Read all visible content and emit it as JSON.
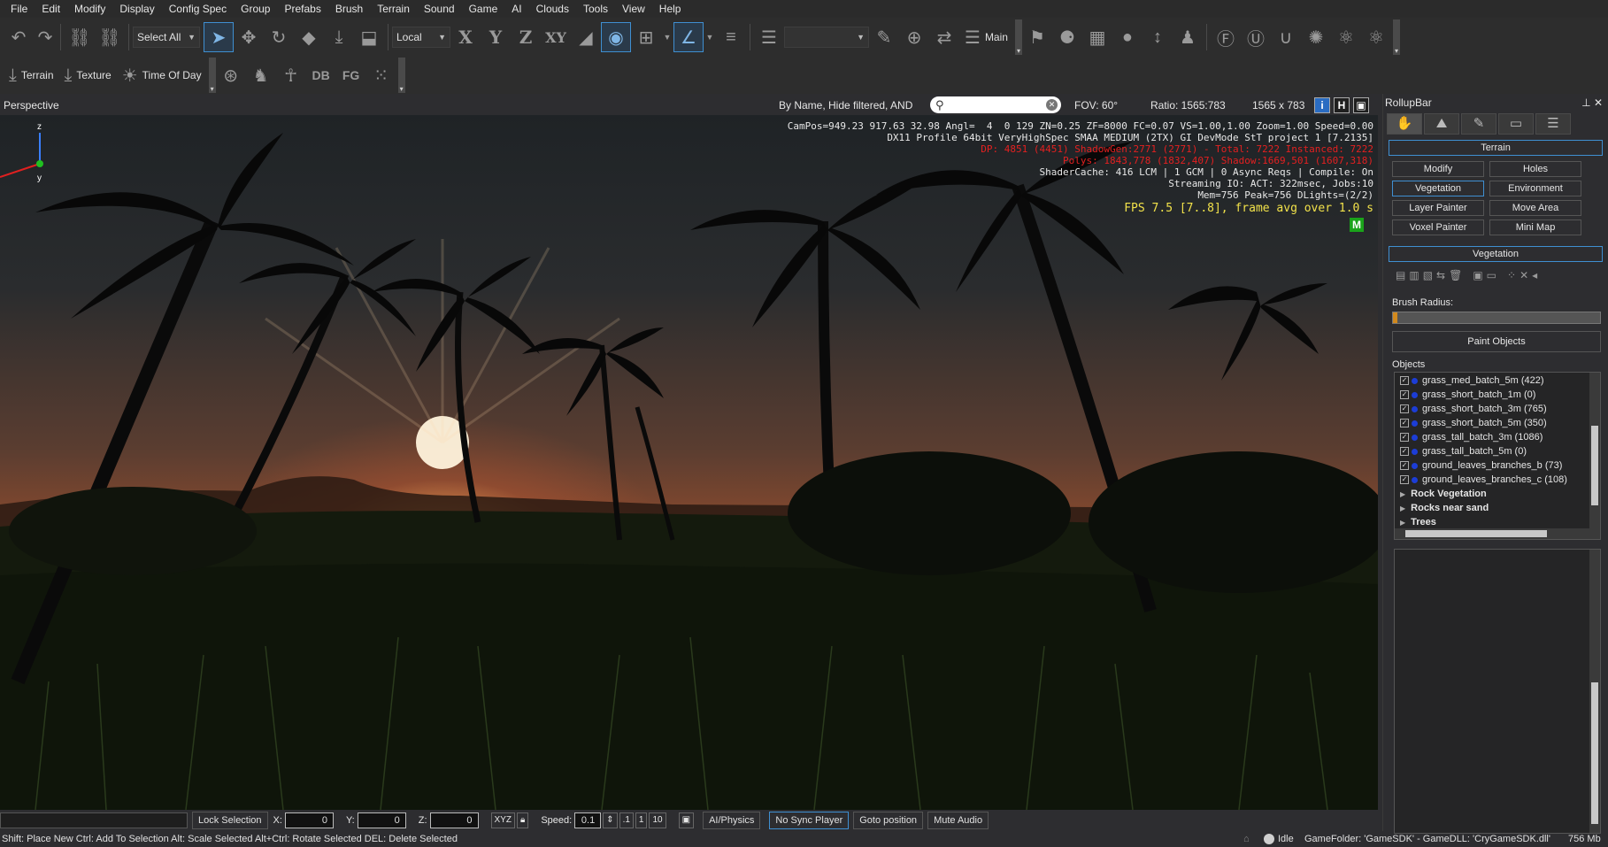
{
  "menu": [
    "File",
    "Edit",
    "Modify",
    "Display",
    "Config Spec",
    "Group",
    "Prefabs",
    "Brush",
    "Terrain",
    "Sound",
    "Game",
    "AI",
    "Clouds",
    "Tools",
    "View",
    "Help"
  ],
  "toolbar1": {
    "select_all": "Select All",
    "coord_system": "Local",
    "axis_x": "X",
    "axis_y": "Y",
    "axis_z": "Z",
    "axis_xy": "XY",
    "layer": "Main"
  },
  "toolbar2": {
    "terrain": "Terrain",
    "texture": "Texture",
    "time_of_day": "Time Of Day",
    "db": "DB",
    "fg": "FG"
  },
  "viewport": {
    "title": "Perspective",
    "filter": "By Name, Hide filtered, AND",
    "search_value": "",
    "fov": "FOV:   60°",
    "ratio": "Ratio: 1565:783",
    "resolution": "1565 x 783",
    "btn_i": "i",
    "btn_h": "H"
  },
  "hud": {
    "line1": "CamPos=949.23 917.63 32.98 Angl=  4  0 129 ZN=0.25 ZF=8000 FC=0.07 VS=1.00,1.00 Zoom=1.00 Speed=0.00",
    "line2": "DX11 Profile 64bit VeryHighSpec SMAA MEDIUM (2TX) GI DevMode StT project 1 [7.2135]",
    "line3": "DP: 4851 (4451) ShadowGen:2771 (2771) - Total: 7222 Instanced: 7222",
    "line4": "Polys: 1843,778 (1832,407) Shadow:1669,501 (1607,318)",
    "line5": "ShaderCache: 416 LCM | 1 GCM | 0 Async Reqs | Compile: On",
    "line6": "Streaming IO: ACT: 322msec, Jobs:10",
    "line7": "Mem=756 Peak=756 DLights=(2/2)",
    "fps": "FPS 7.5 [7..8], frame avg over 1.0 s",
    "badge": "M"
  },
  "axes": {
    "z": "z",
    "y": "y"
  },
  "status": {
    "lock_selection": "Lock Selection",
    "x_label": "X:",
    "x_value": "0",
    "y_label": "Y:",
    "y_value": "0",
    "z_label": "Z:",
    "z_value": "0",
    "xyz": "XYZ",
    "speed_label": "Speed:",
    "speed_value": "0.1",
    "speed_a": ".1",
    "speed_b": "1",
    "speed_c": "10",
    "ai_physics": "AI/Physics",
    "no_sync": "No Sync Player",
    "goto": "Goto position",
    "mute": "Mute Audio",
    "hint": "Shift: Place New  Ctrl: Add To Selection  Alt: Scale Selected  Alt+Ctrl: Rotate Selected DEL: Delete Selected",
    "state": "Idle",
    "game_folder": "GameFolder: 'GameSDK' - GameDLL: 'CryGameSDK.dll'",
    "memory": "756 Mb"
  },
  "rollup": {
    "title": "RollupBar",
    "terrain_header": "Terrain",
    "buttons": [
      "Modify",
      "Holes",
      "Vegetation",
      "Environment",
      "Layer Painter",
      "Move Area",
      "Voxel Painter",
      "Mini Map"
    ],
    "vegetation_header": "Vegetation",
    "brush_radius_label": "Brush Radius:",
    "brush_radius_fraction": 0.02,
    "paint_objects": "Paint Objects",
    "objects_label": "Objects",
    "objects": [
      "grass_med_batch_5m (422)",
      "grass_short_batch_1m (0)",
      "grass_short_batch_3m (765)",
      "grass_short_batch_5m (350)",
      "grass_tall_batch_3m (1086)",
      "grass_tall_batch_5m (0)",
      "ground_leaves_branches_b (73)",
      "ground_leaves_branches_c (108)"
    ],
    "groups": [
      "Rock Vegetation",
      "Rocks near sand",
      "Trees"
    ]
  },
  "colors": {
    "accent": "#3f8fd1",
    "hud_red": "#e32020",
    "hud_fps": "#f2e24a",
    "badge_green": "#1aa31a",
    "object_dot": "#1c3dd6"
  }
}
